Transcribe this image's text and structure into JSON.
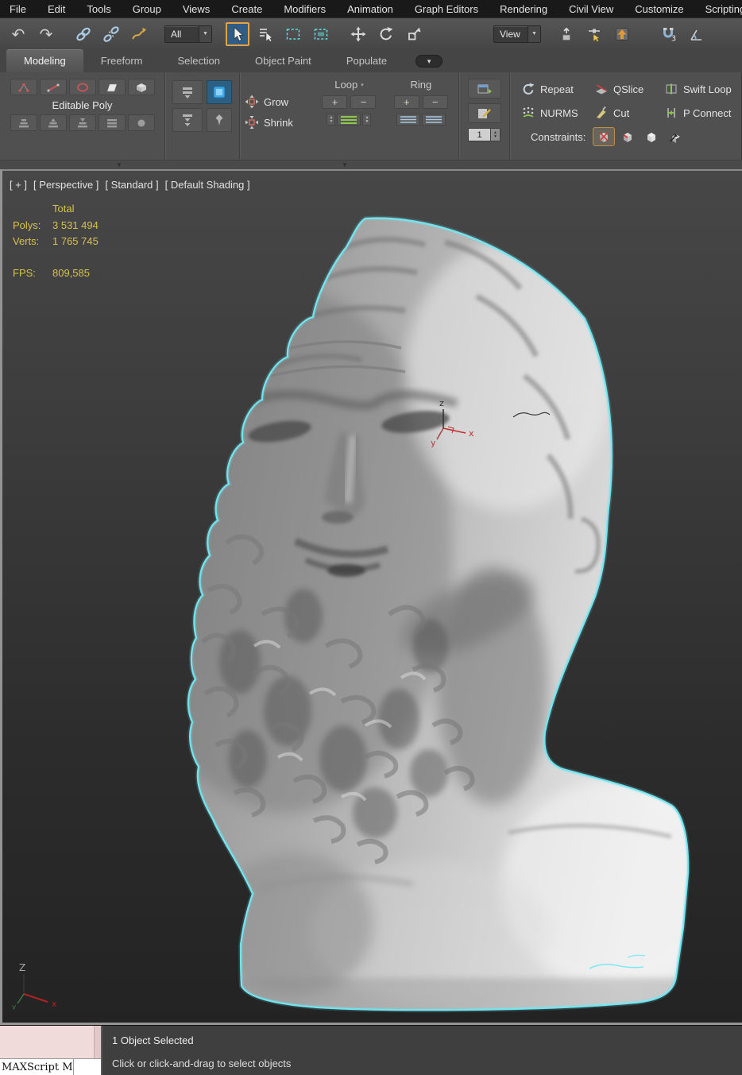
{
  "colors": {
    "accent_cyan": "#73e9f3",
    "active_tool_border": "#e2a24a",
    "stats_yellow": "#d4c24c"
  },
  "icons": {
    "undo": "↶",
    "redo": "↷",
    "caret_down": "▼",
    "caret_small": "▾",
    "plus": "+",
    "minus": "−",
    "spin_up": "▲",
    "spin_down": "▼",
    "collapse_arrow": "▼"
  },
  "menu": {
    "items": [
      "File",
      "Edit",
      "Tools",
      "Group",
      "Views",
      "Create",
      "Modifiers",
      "Animation",
      "Graph Editors",
      "Rendering",
      "Civil View",
      "Customize",
      "Scripting"
    ]
  },
  "toolbar": {
    "selection_filter": "All",
    "reference_coordsys": "View"
  },
  "ribbon": {
    "tabs": [
      {
        "label": "Modeling"
      },
      {
        "label": "Freeform"
      },
      {
        "label": "Selection"
      },
      {
        "label": "Object Paint"
      },
      {
        "label": "Populate"
      }
    ],
    "editable_poly_title": "Editable Poly",
    "grow_label": "Grow",
    "shrink_label": "Shrink",
    "loop_label": "Loop",
    "ring_label": "Ring",
    "spinner_value": "1",
    "repeat_label": "Repeat",
    "qslice_label": "QSlice",
    "swift_loop_label": "Swift Loop",
    "nurms_label": "NURMS",
    "cut_label": "Cut",
    "p_connect_label": "P Connect",
    "constraints_label": "Constraints:"
  },
  "viewport": {
    "label_segments": {
      "menu": "[ + ]",
      "pov": "[ Perspective ]",
      "standard": "[ Standard ]",
      "shading": "[ Default Shading ]"
    },
    "stats": {
      "total_label": "Total",
      "polys_label": "Polys:",
      "polys_value": "3 531 494",
      "verts_label": "Verts:",
      "verts_value": "1 765 745",
      "fps_label": "FPS:",
      "fps_value": "809,585"
    },
    "axis_gizmo": {
      "x": "x",
      "y": "y",
      "z": "z"
    },
    "world_axis": {
      "x": "x",
      "y": "y",
      "z": "Z"
    }
  },
  "status": {
    "maxscript_label": "MAXScript Mini",
    "selection": "1 Object Selected",
    "prompt": "Click or click-and-drag to select objects"
  }
}
